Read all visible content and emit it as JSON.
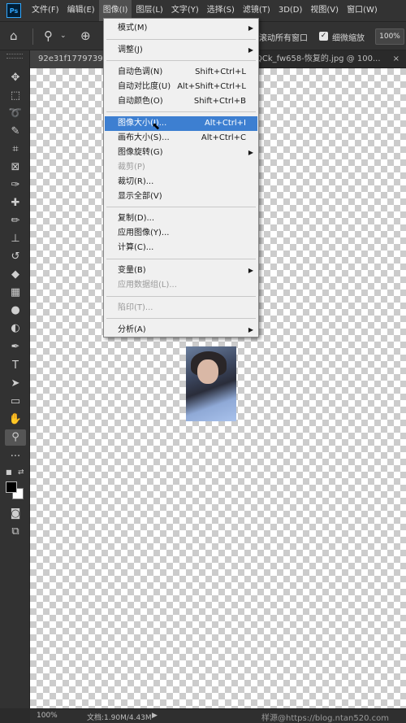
{
  "app": {
    "logo": "Ps",
    "menubar": [
      "文件(F)",
      "编辑(E)",
      "图像(I)",
      "图层(L)",
      "文字(Y)",
      "选择(S)",
      "滤镜(T)",
      "3D(D)",
      "视图(V)",
      "窗口(W)"
    ]
  },
  "options_bar": {
    "home_icon": "home-icon",
    "zoom_tool_icon": "zoom-icon",
    "dropdown_icon": "chevron-down-icon",
    "zoom_in_icon": "zoom-in-icon",
    "scroll_all_label": "滚动所有窗口",
    "scrubby_zoom_checked": "✓",
    "scrubby_zoom_label": "细微缩放",
    "zoom_value": "100%"
  },
  "tabs": {
    "tab1": "92e31f1779739d",
    "tab2": "QCk_fw658-恢复的.jpg @ 100...",
    "tab2_close": "×"
  },
  "dropdown": {
    "items": [
      {
        "label": "模式(M)",
        "shortcut": "",
        "submenu": "▶"
      },
      {
        "label": "调整(J)",
        "shortcut": "",
        "submenu": "▶"
      },
      {
        "label": "自动色调(N)",
        "shortcut": "Shift+Ctrl+L",
        "submenu": ""
      },
      {
        "label": "自动对比度(U)",
        "shortcut": "Alt+Shift+Ctrl+L",
        "submenu": ""
      },
      {
        "label": "自动颜色(O)",
        "shortcut": "Shift+Ctrl+B",
        "submenu": ""
      },
      {
        "label": "图像大小(I)...",
        "shortcut": "Alt+Ctrl+I",
        "submenu": ""
      },
      {
        "label": "画布大小(S)...",
        "shortcut": "Alt+Ctrl+C",
        "submenu": ""
      },
      {
        "label": "图像旋转(G)",
        "shortcut": "",
        "submenu": "▶"
      },
      {
        "label": "裁剪(P)",
        "shortcut": "",
        "submenu": ""
      },
      {
        "label": "裁切(R)...",
        "shortcut": "",
        "submenu": ""
      },
      {
        "label": "显示全部(V)",
        "shortcut": "",
        "submenu": ""
      },
      {
        "label": "复制(D)...",
        "shortcut": "",
        "submenu": ""
      },
      {
        "label": "应用图像(Y)...",
        "shortcut": "",
        "submenu": ""
      },
      {
        "label": "计算(C)...",
        "shortcut": "",
        "submenu": ""
      },
      {
        "label": "变量(B)",
        "shortcut": "",
        "submenu": "▶"
      },
      {
        "label": "应用数据组(L)...",
        "shortcut": "",
        "submenu": ""
      },
      {
        "label": "陷印(T)...",
        "shortcut": "",
        "submenu": ""
      },
      {
        "label": "分析(A)",
        "shortcut": "",
        "submenu": "▶"
      }
    ],
    "cursor": "⬉"
  },
  "toolbar": {
    "tools": [
      {
        "name": "move-tool-icon",
        "glyph": "✥"
      },
      {
        "name": "marquee-tool-icon",
        "glyph": "⬚"
      },
      {
        "name": "lasso-tool-icon",
        "glyph": "➰"
      },
      {
        "name": "quick-select-tool-icon",
        "glyph": "✎"
      },
      {
        "name": "crop-tool-icon",
        "glyph": "⌗"
      },
      {
        "name": "frame-tool-icon",
        "glyph": "⊠"
      },
      {
        "name": "eyedropper-tool-icon",
        "glyph": "✑"
      },
      {
        "name": "healing-brush-tool-icon",
        "glyph": "✚"
      },
      {
        "name": "brush-tool-icon",
        "glyph": "✏"
      },
      {
        "name": "clone-stamp-tool-icon",
        "glyph": "⊥"
      },
      {
        "name": "history-brush-tool-icon",
        "glyph": "↺"
      },
      {
        "name": "eraser-tool-icon",
        "glyph": "◆"
      },
      {
        "name": "gradient-tool-icon",
        "glyph": "▦"
      },
      {
        "name": "blur-tool-icon",
        "glyph": "●"
      },
      {
        "name": "dodge-tool-icon",
        "glyph": "◐"
      },
      {
        "name": "pen-tool-icon",
        "glyph": "✒"
      },
      {
        "name": "type-tool-icon",
        "glyph": "T"
      },
      {
        "name": "path-select-tool-icon",
        "glyph": "➤"
      },
      {
        "name": "rectangle-tool-icon",
        "glyph": "▭"
      },
      {
        "name": "hand-tool-icon",
        "glyph": "✋"
      },
      {
        "name": "zoom-tool-icon",
        "glyph": "⚲"
      },
      {
        "name": "more-tools-icon",
        "glyph": "···"
      },
      {
        "name": "quick-mask-icon",
        "glyph": "◙"
      },
      {
        "name": "screen-mode-icon",
        "glyph": "⧉"
      }
    ],
    "swap_colors": "⇄",
    "default_colors": "■"
  },
  "status": {
    "zoom": "100%",
    "doc": "文档:1.90M/4.43M",
    "arrow": "▶",
    "watermark": "样源@https://blog.ntan520.com"
  },
  "colors": {
    "highlight": "#3d7fd1",
    "menu_bg": "#f0f0f0",
    "ui_bg": "#323232"
  }
}
